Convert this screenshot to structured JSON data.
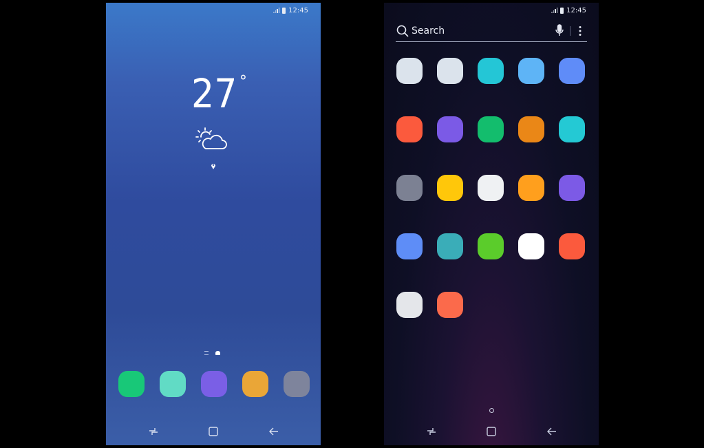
{
  "status": {
    "time": "12:45"
  },
  "home": {
    "weather": {
      "temperature": "27",
      "degree_symbol": "°",
      "icon": "partly-cloudy-icon",
      "location_icon": "location-pin-icon"
    },
    "page_indicator": [
      "page-lines-icon",
      "home-page-icon"
    ],
    "dock": [
      {
        "name": "dock-app-1",
        "color": "#18c878"
      },
      {
        "name": "dock-app-2",
        "color": "#61dbc5"
      },
      {
        "name": "dock-app-3",
        "color": "#7a5fe6"
      },
      {
        "name": "dock-app-4",
        "color": "#eaa637"
      },
      {
        "name": "dock-app-5",
        "color": "#7e849c"
      }
    ]
  },
  "drawer": {
    "search": {
      "label": "Search",
      "icons": [
        "search-icon",
        "microphone-icon",
        "more-options-icon"
      ]
    },
    "apps": [
      {
        "color": "#dbe3ec"
      },
      {
        "color": "#dbe3ec"
      },
      {
        "color": "#24c6d6"
      },
      {
        "color": "#5eb4f6"
      },
      {
        "color": "#5f8cf8"
      },
      {
        "color": "#fb5a3d"
      },
      {
        "color": "#7b5ae6"
      },
      {
        "color": "#13bd6d"
      },
      {
        "color": "#ea8717"
      },
      {
        "color": "#24c9d4"
      },
      {
        "color": "#7c8193"
      },
      {
        "color": "#ffc70a"
      },
      {
        "color": "#eff1f3"
      },
      {
        "color": "#ff9f1d"
      },
      {
        "color": "#7c5ae6"
      },
      {
        "color": "#5e8df7"
      },
      {
        "color": "#3aadb8"
      },
      {
        "color": "#5bcc2b"
      },
      {
        "color": "#ffffff"
      },
      {
        "color": "#fb5a3d"
      },
      {
        "color": "#e4e6ea"
      },
      {
        "color": "#fb6a4b"
      }
    ]
  },
  "navbar": [
    "recents-icon",
    "home-icon",
    "back-icon"
  ]
}
